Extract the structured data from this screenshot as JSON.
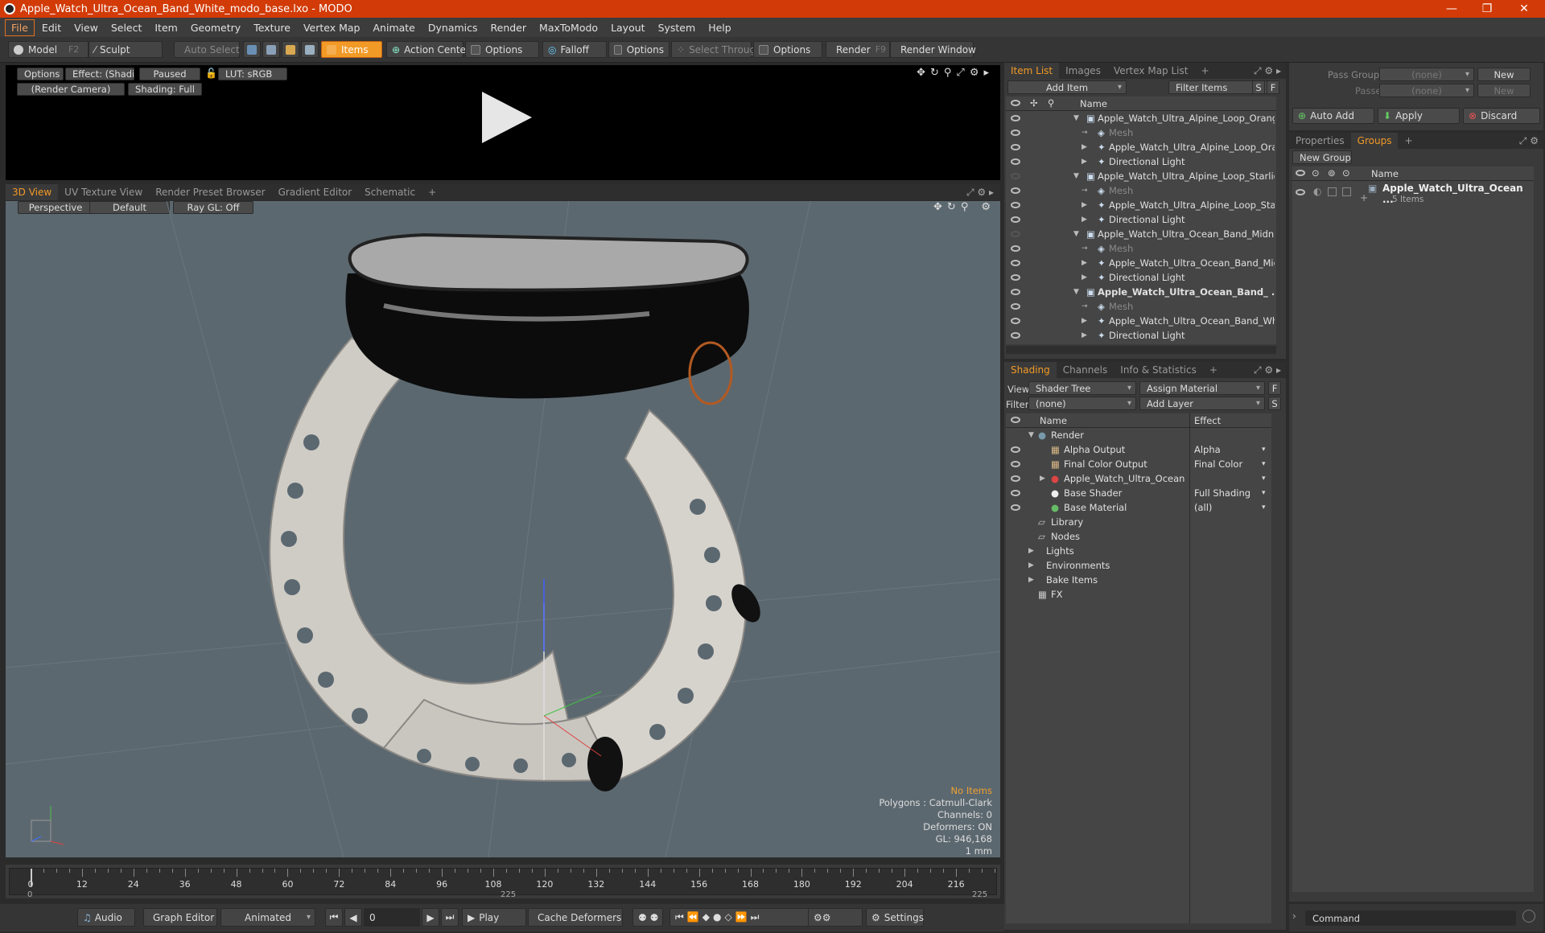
{
  "window": {
    "title": "Apple_Watch_Ultra_Ocean_Band_White_modo_base.lxo - MODO"
  },
  "menu": [
    "File",
    "Edit",
    "View",
    "Select",
    "Item",
    "Geometry",
    "Texture",
    "Vertex Map",
    "Animate",
    "Dynamics",
    "Render",
    "MaxToModo",
    "Layout",
    "System",
    "Help"
  ],
  "toolbar": {
    "model": "Model",
    "model_key": "F2",
    "sculpt": "Sculpt",
    "auto_select": "Auto Select",
    "items": "Items",
    "action_center": "Action Center",
    "options1": "Options",
    "falloff": "Falloff",
    "options2": "Options",
    "select_through": "Select Through",
    "options3": "Options",
    "render": "Render",
    "render_key": "F9",
    "render_window": "Render Window"
  },
  "preview": {
    "options": "Options",
    "effect": "Effect: (Shadi...",
    "paused": "Paused",
    "lut": "LUT: sRGB",
    "camera": "(Render Camera)",
    "shading": "Shading: Full"
  },
  "view_tabs": [
    "3D View",
    "UV Texture View",
    "Render Preset Browser",
    "Gradient Editor",
    "Schematic"
  ],
  "viewport": {
    "perspective": "Perspective",
    "default": "Default",
    "raygl": "Ray GL: Off",
    "stats": [
      "No Items",
      "Polygons : Catmull-Clark",
      "Channels: 0",
      "Deformers: ON",
      "GL: 946,168",
      "1 mm"
    ]
  },
  "timeline": {
    "ticks": [
      "0",
      "12",
      "24",
      "36",
      "48",
      "60",
      "72",
      "84",
      "96",
      "108",
      "120",
      "132",
      "144",
      "156",
      "168",
      "180",
      "192",
      "204",
      "216"
    ],
    "bottom_left": "0",
    "bottom_mid": "225",
    "bottom_right": "225"
  },
  "bottombar": {
    "audio": "Audio",
    "graph_editor": "Graph Editor",
    "animated": "Animated",
    "frame": "0",
    "play": "Play",
    "cache_deformers": "Cache Deformers",
    "settings": "Settings"
  },
  "itemlist": {
    "tabs": [
      "Item List",
      "Images",
      "Vertex Map List"
    ],
    "add_item": "Add Item",
    "filter_items": "Filter Items",
    "s": "S",
    "f": "F",
    "col_name": "Name",
    "rows": [
      {
        "label": "Apple_Watch_Ultra_Alpine_Loop_Orange ...",
        "level": 0,
        "vis": true,
        "bold": false,
        "dim": false
      },
      {
        "label": "Mesh",
        "level": 1,
        "vis": true,
        "bold": false,
        "dim": true
      },
      {
        "label": "Apple_Watch_Ultra_Alpine_Loop_Oran ...",
        "level": 1,
        "vis": true,
        "bold": false,
        "dim": false
      },
      {
        "label": "Directional Light",
        "level": 1,
        "vis": true,
        "bold": false,
        "dim": false
      },
      {
        "label": "Apple_Watch_Ultra_Alpine_Loop_Starligh ...",
        "level": 0,
        "vis": false,
        "bold": false,
        "dim": false
      },
      {
        "label": "Mesh",
        "level": 1,
        "vis": true,
        "bold": false,
        "dim": true
      },
      {
        "label": "Apple_Watch_Ultra_Alpine_Loop_Starli ...",
        "level": 1,
        "vis": true,
        "bold": false,
        "dim": false
      },
      {
        "label": "Directional Light",
        "level": 1,
        "vis": true,
        "bold": false,
        "dim": false
      },
      {
        "label": "Apple_Watch_Ultra_Ocean_Band_Midnigh...",
        "level": 0,
        "vis": false,
        "bold": false,
        "dim": false
      },
      {
        "label": "Mesh",
        "level": 1,
        "vis": true,
        "bold": false,
        "dim": true
      },
      {
        "label": "Apple_Watch_Ultra_Ocean_Band_Midni...",
        "level": 1,
        "vis": true,
        "bold": false,
        "dim": false
      },
      {
        "label": "Directional Light",
        "level": 1,
        "vis": true,
        "bold": false,
        "dim": false
      },
      {
        "label": "Apple_Watch_Ultra_Ocean_Band_ ...",
        "level": 0,
        "vis": true,
        "bold": true,
        "dim": false
      },
      {
        "label": "Mesh",
        "level": 1,
        "vis": true,
        "bold": false,
        "dim": true
      },
      {
        "label": "Apple_Watch_Ultra_Ocean_Band_Whit ...",
        "level": 1,
        "vis": true,
        "bold": false,
        "dim": false
      },
      {
        "label": "Directional Light",
        "level": 1,
        "vis": true,
        "bold": false,
        "dim": false
      }
    ]
  },
  "shading": {
    "tabs": [
      "Shading",
      "Channels",
      "Info & Statistics"
    ],
    "view_label": "View",
    "view_value": "Shader Tree",
    "assign_material": "Assign Material",
    "f": "F",
    "filter_label": "Filter",
    "filter_value": "(none)",
    "add_layer": "Add Layer",
    "s": "S",
    "col_name": "Name",
    "col_effect": "Effect",
    "rows": [
      {
        "label": "Render",
        "effect": "",
        "indent": 0,
        "vis": false
      },
      {
        "label": "Alpha Output",
        "effect": "Alpha",
        "indent": 1,
        "vis": true
      },
      {
        "label": "Final Color Output",
        "effect": "Final Color",
        "indent": 1,
        "vis": true
      },
      {
        "label": "Apple_Watch_Ultra_Ocean ...",
        "effect": "",
        "indent": 1,
        "vis": true
      },
      {
        "label": "Base Shader",
        "effect": "Full Shading",
        "indent": 1,
        "vis": true
      },
      {
        "label": "Base Material",
        "effect": "(all)",
        "indent": 1,
        "vis": true
      },
      {
        "label": "Library",
        "effect": "",
        "indent": 0,
        "vis": false
      },
      {
        "label": "Nodes",
        "effect": "",
        "indent": 0,
        "vis": false
      },
      {
        "label": "Lights",
        "effect": "",
        "indent": -1,
        "vis": false
      },
      {
        "label": "Environments",
        "effect": "",
        "indent": -1,
        "vis": false
      },
      {
        "label": "Bake Items",
        "effect": "",
        "indent": -1,
        "vis": false
      },
      {
        "label": "FX",
        "effect": "",
        "indent": 0,
        "vis": false
      }
    ]
  },
  "passes": {
    "pass_groups": "Pass Groups",
    "passes": "Passes",
    "none1": "(none)",
    "none2": "(none)",
    "new1": "New",
    "new2": "New",
    "auto_add": "Auto Add",
    "apply": "Apply",
    "discard": "Discard"
  },
  "groups": {
    "tabs": [
      "Properties",
      "Groups"
    ],
    "new_group": "New Group",
    "col_name": "Name",
    "item": "Apple_Watch_Ultra_Ocean ...",
    "item_sub": "5 Items"
  },
  "command": {
    "placeholder": "Command"
  }
}
